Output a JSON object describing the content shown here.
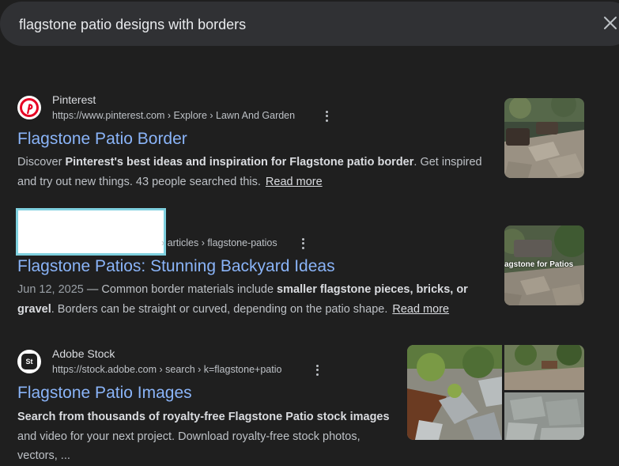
{
  "search": {
    "query": "flagstone patio designs with borders"
  },
  "icons": {
    "close": "close-icon",
    "more": "more-vert-icon"
  },
  "results": [
    {
      "site": "Pinterest",
      "url": "https://www.pinterest.com › Explore › Lawn And Garden",
      "title": "Flagstone Patio Border",
      "snippet": {
        "t1": "Discover ",
        "b1": "Pinterest's best ideas and inspiration for Flagstone patio border",
        "t2": ". Get inspired and try out new things. 43 people searched this.",
        "read_more": "Read more"
      }
    },
    {
      "site": "",
      "url": "› articles › flagstone-patios",
      "title": "Flagstone Patios: Stunning Backyard Ideas",
      "thumb_overlay": "agstone for Patios",
      "snippet": {
        "date": "Jun 12, 2025",
        "t1": " — Common border materials include ",
        "b1": "smaller flagstone pieces, bricks, or gravel",
        "t2": ". Borders can be straight or curved, depending on the patio shape.",
        "read_more": "Read more"
      }
    },
    {
      "site": "Adobe Stock",
      "favicon_text": "St",
      "url": "https://stock.adobe.com › search › k=flagstone+patio",
      "title": "Flagstone Patio Images",
      "snippet": {
        "b1": "Search from thousands of royalty-free Flagstone Patio stock images",
        "t1": " and video for your next project. Download royalty-free stock photos, vectors, ..."
      }
    }
  ],
  "colors": {
    "background": "#1f1f1f",
    "link": "#8ab4f8",
    "search_bar": "#303134"
  }
}
